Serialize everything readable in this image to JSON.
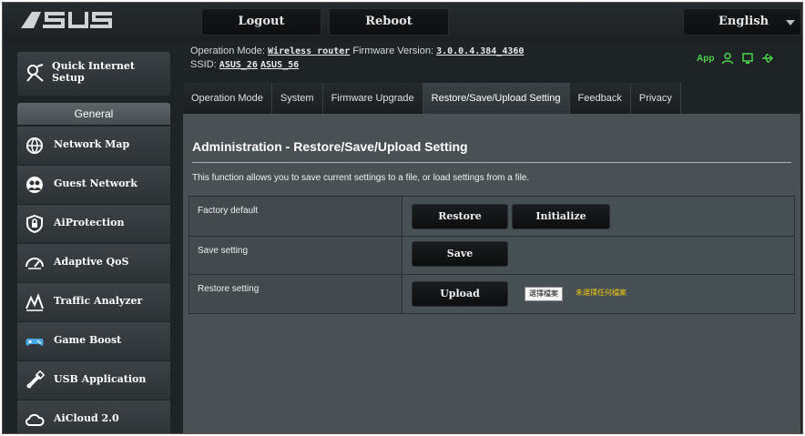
{
  "topbar": {
    "logout": "Logout",
    "reboot": "Reboot",
    "language": "English"
  },
  "info": {
    "op_mode_label": "Operation Mode:",
    "op_mode_value": "Wireless router",
    "fw_label": "Firmware Version:",
    "fw_value": "3.0.0.4.384_4360",
    "ssid_label": "SSID:",
    "ssid_1": "ASUS_26",
    "ssid_2": "ASUS_56",
    "app_label": "App"
  },
  "tabs": [
    {
      "label": "Operation Mode",
      "active": false
    },
    {
      "label": "System",
      "active": false
    },
    {
      "label": "Firmware Upgrade",
      "active": false
    },
    {
      "label": "Restore/Save/Upload Setting",
      "active": true
    },
    {
      "label": "Feedback",
      "active": false
    },
    {
      "label": "Privacy",
      "active": false
    }
  ],
  "sidebar": {
    "quick_setup_line1": "Quick Internet",
    "quick_setup_line2": "Setup",
    "section": "General",
    "items": [
      {
        "label": "Network Map",
        "icon": "globe-icon"
      },
      {
        "label": "Guest Network",
        "icon": "guests-icon"
      },
      {
        "label": "AiProtection",
        "icon": "shield-icon"
      },
      {
        "label": "Adaptive QoS",
        "icon": "gauge-icon"
      },
      {
        "label": "Traffic Analyzer",
        "icon": "traffic-icon"
      },
      {
        "label": "Game Boost",
        "icon": "gamepad-icon"
      },
      {
        "label": "USB Application",
        "icon": "usb-icon"
      },
      {
        "label": "AiCloud 2.0",
        "icon": "cloud-icon"
      }
    ]
  },
  "main": {
    "title": "Administration - Restore/Save/Upload Setting",
    "description": "This function allows you to save current settings to a file, or load settings from a file.",
    "rows": {
      "factory_label": "Factory default",
      "restore_btn": "Restore",
      "initialize_btn": "Initialize",
      "save_label": "Save setting",
      "save_btn": "Save",
      "restore_label": "Restore setting",
      "upload_btn": "Upload",
      "choose_file": "選擇檔案",
      "no_file": "未選擇任何檔案"
    }
  },
  "colors": {
    "accent_green": "#4cd44c",
    "warning_yellow": "#f2c811",
    "content_bg": "#4a5155"
  }
}
